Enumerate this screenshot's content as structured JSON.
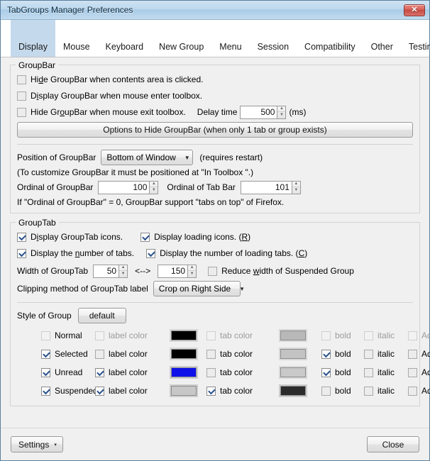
{
  "window": {
    "title": "TabGroups Manager Preferences",
    "close_icon": "close-icon",
    "close_glyph": "✕"
  },
  "tabs": [
    {
      "label": "Display",
      "selected": true
    },
    {
      "label": "Mouse",
      "selected": false
    },
    {
      "label": "Keyboard",
      "selected": false
    },
    {
      "label": "New Group",
      "selected": false
    },
    {
      "label": "Menu",
      "selected": false
    },
    {
      "label": "Session",
      "selected": false
    },
    {
      "label": "Compatibility",
      "selected": false
    },
    {
      "label": "Other",
      "selected": false
    },
    {
      "label": "Testing",
      "selected": false
    }
  ],
  "groupbar": {
    "legend": "GroupBar",
    "cb_hide_on_content_click": "Hide GroupBar when contents area is clicked.",
    "cb_display_on_mouse_enter": "Display GroupBar when mouse enter toolbox.",
    "cb_hide_on_mouse_exit": "Hide GroupBar when mouse exit toolbox.",
    "delay_time_label": "Delay time",
    "delay_time_value": "500",
    "delay_time_unit": "(ms)",
    "options_button": "Options to Hide GroupBar (when only 1 tab or group exists)"
  },
  "position": {
    "label": "Position of GroupBar",
    "selected": "Bottom of Window",
    "options": [
      "Bottom of Window"
    ],
    "requires_restart": "(requires restart)",
    "customize_note": "(To customize GroupBar it must be positioned at \"In Toolbox \".)",
    "ordinal_groupbar_label": "Ordinal of GroupBar",
    "ordinal_groupbar_value": "100",
    "ordinal_tabbar_label": "Ordinal of Tab Bar",
    "ordinal_tabbar_value": "101",
    "ordinal_note": "If \"Ordinal of GroupBar\" = 0, GroupBar support \"tabs on top\" of Firefox."
  },
  "grouptab": {
    "legend": "GroupTab",
    "cb_display_icons": "Display GroupTab icons.",
    "cb_display_loading_icons": "Display loading icons. (R)",
    "cb_display_number_tabs": "Display the number of tabs.",
    "cb_display_number_loading_tabs": "Display the number of loading tabs. (C)",
    "width_label": "Width of GroupTab",
    "width_min": "50",
    "width_arrow": "<-->",
    "width_max": "150",
    "cb_reduce_width": "Reduce width of Suspended Group",
    "clipping_label": "Clipping method of GroupTab label",
    "clipping_selected": "Crop on Right Side",
    "clipping_options": [
      "Crop on Right Side"
    ]
  },
  "style_of_group": {
    "label": "Style of Group",
    "default_button": "default",
    "col_label_color": "label color",
    "col_tab_color": "tab color",
    "col_bold": "bold",
    "col_italic": "italic",
    "col_advanced": "Advanced",
    "rows": [
      {
        "name": "Normal",
        "name_checked": false,
        "disabled": true,
        "label_color_checked": false,
        "label_color": "#000000",
        "tab_color_checked": false,
        "tab_color": "#b8b8b8",
        "bold": false,
        "italic": false,
        "advanced": false
      },
      {
        "name": "Selected",
        "name_checked": true,
        "disabled": false,
        "label_color_checked": false,
        "label_color": "#000000",
        "tab_color_checked": false,
        "tab_color": "#c3c3c3",
        "bold": true,
        "italic": false,
        "advanced": false
      },
      {
        "name": "Unread",
        "name_checked": true,
        "disabled": false,
        "label_color_checked": true,
        "label_color": "#0f12e8",
        "tab_color_checked": false,
        "tab_color": "#c9c9c9",
        "bold": true,
        "italic": false,
        "advanced": false
      },
      {
        "name": "Suspended",
        "name_checked": true,
        "disabled": false,
        "label_color_checked": true,
        "label_color": "#c7c7c7",
        "tab_color_checked": true,
        "tab_color": "#2b2b2b",
        "bold": false,
        "italic": false,
        "advanced": false
      }
    ]
  },
  "footer": {
    "settings_button": "Settings",
    "settings_caret": "▾",
    "close_button": "Close"
  }
}
